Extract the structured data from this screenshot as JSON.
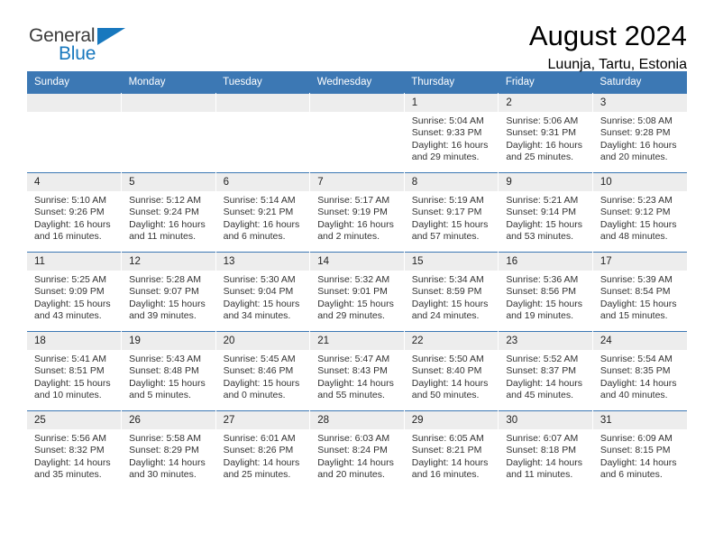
{
  "brand": {
    "name_part1": "General",
    "name_part2": "Blue",
    "triangle_color": "#1878be"
  },
  "header": {
    "title": "August 2024",
    "subtitle": "Luunja, Tartu, Estonia",
    "accent_color": "#3c78b4"
  },
  "weekdays": [
    "Sunday",
    "Monday",
    "Tuesday",
    "Wednesday",
    "Thursday",
    "Friday",
    "Saturday"
  ],
  "labels": {
    "sunrise": "Sunrise:",
    "sunset": "Sunset:",
    "daylight": "Daylight:"
  },
  "weeks": [
    [
      {
        "day": "",
        "blank": true
      },
      {
        "day": "",
        "blank": true
      },
      {
        "day": "",
        "blank": true
      },
      {
        "day": "",
        "blank": true
      },
      {
        "day": "1",
        "sunrise": "Sunrise: 5:04 AM",
        "sunset": "Sunset: 9:33 PM",
        "daylight1": "Daylight: 16 hours",
        "daylight2": "and 29 minutes."
      },
      {
        "day": "2",
        "sunrise": "Sunrise: 5:06 AM",
        "sunset": "Sunset: 9:31 PM",
        "daylight1": "Daylight: 16 hours",
        "daylight2": "and 25 minutes."
      },
      {
        "day": "3",
        "sunrise": "Sunrise: 5:08 AM",
        "sunset": "Sunset: 9:28 PM",
        "daylight1": "Daylight: 16 hours",
        "daylight2": "and 20 minutes."
      }
    ],
    [
      {
        "day": "4",
        "sunrise": "Sunrise: 5:10 AM",
        "sunset": "Sunset: 9:26 PM",
        "daylight1": "Daylight: 16 hours",
        "daylight2": "and 16 minutes."
      },
      {
        "day": "5",
        "sunrise": "Sunrise: 5:12 AM",
        "sunset": "Sunset: 9:24 PM",
        "daylight1": "Daylight: 16 hours",
        "daylight2": "and 11 minutes."
      },
      {
        "day": "6",
        "sunrise": "Sunrise: 5:14 AM",
        "sunset": "Sunset: 9:21 PM",
        "daylight1": "Daylight: 16 hours",
        "daylight2": "and 6 minutes."
      },
      {
        "day": "7",
        "sunrise": "Sunrise: 5:17 AM",
        "sunset": "Sunset: 9:19 PM",
        "daylight1": "Daylight: 16 hours",
        "daylight2": "and 2 minutes."
      },
      {
        "day": "8",
        "sunrise": "Sunrise: 5:19 AM",
        "sunset": "Sunset: 9:17 PM",
        "daylight1": "Daylight: 15 hours",
        "daylight2": "and 57 minutes."
      },
      {
        "day": "9",
        "sunrise": "Sunrise: 5:21 AM",
        "sunset": "Sunset: 9:14 PM",
        "daylight1": "Daylight: 15 hours",
        "daylight2": "and 53 minutes."
      },
      {
        "day": "10",
        "sunrise": "Sunrise: 5:23 AM",
        "sunset": "Sunset: 9:12 PM",
        "daylight1": "Daylight: 15 hours",
        "daylight2": "and 48 minutes."
      }
    ],
    [
      {
        "day": "11",
        "sunrise": "Sunrise: 5:25 AM",
        "sunset": "Sunset: 9:09 PM",
        "daylight1": "Daylight: 15 hours",
        "daylight2": "and 43 minutes."
      },
      {
        "day": "12",
        "sunrise": "Sunrise: 5:28 AM",
        "sunset": "Sunset: 9:07 PM",
        "daylight1": "Daylight: 15 hours",
        "daylight2": "and 39 minutes."
      },
      {
        "day": "13",
        "sunrise": "Sunrise: 5:30 AM",
        "sunset": "Sunset: 9:04 PM",
        "daylight1": "Daylight: 15 hours",
        "daylight2": "and 34 minutes."
      },
      {
        "day": "14",
        "sunrise": "Sunrise: 5:32 AM",
        "sunset": "Sunset: 9:01 PM",
        "daylight1": "Daylight: 15 hours",
        "daylight2": "and 29 minutes."
      },
      {
        "day": "15",
        "sunrise": "Sunrise: 5:34 AM",
        "sunset": "Sunset: 8:59 PM",
        "daylight1": "Daylight: 15 hours",
        "daylight2": "and 24 minutes."
      },
      {
        "day": "16",
        "sunrise": "Sunrise: 5:36 AM",
        "sunset": "Sunset: 8:56 PM",
        "daylight1": "Daylight: 15 hours",
        "daylight2": "and 19 minutes."
      },
      {
        "day": "17",
        "sunrise": "Sunrise: 5:39 AM",
        "sunset": "Sunset: 8:54 PM",
        "daylight1": "Daylight: 15 hours",
        "daylight2": "and 15 minutes."
      }
    ],
    [
      {
        "day": "18",
        "sunrise": "Sunrise: 5:41 AM",
        "sunset": "Sunset: 8:51 PM",
        "daylight1": "Daylight: 15 hours",
        "daylight2": "and 10 minutes."
      },
      {
        "day": "19",
        "sunrise": "Sunrise: 5:43 AM",
        "sunset": "Sunset: 8:48 PM",
        "daylight1": "Daylight: 15 hours",
        "daylight2": "and 5 minutes."
      },
      {
        "day": "20",
        "sunrise": "Sunrise: 5:45 AM",
        "sunset": "Sunset: 8:46 PM",
        "daylight1": "Daylight: 15 hours",
        "daylight2": "and 0 minutes."
      },
      {
        "day": "21",
        "sunrise": "Sunrise: 5:47 AM",
        "sunset": "Sunset: 8:43 PM",
        "daylight1": "Daylight: 14 hours",
        "daylight2": "and 55 minutes."
      },
      {
        "day": "22",
        "sunrise": "Sunrise: 5:50 AM",
        "sunset": "Sunset: 8:40 PM",
        "daylight1": "Daylight: 14 hours",
        "daylight2": "and 50 minutes."
      },
      {
        "day": "23",
        "sunrise": "Sunrise: 5:52 AM",
        "sunset": "Sunset: 8:37 PM",
        "daylight1": "Daylight: 14 hours",
        "daylight2": "and 45 minutes."
      },
      {
        "day": "24",
        "sunrise": "Sunrise: 5:54 AM",
        "sunset": "Sunset: 8:35 PM",
        "daylight1": "Daylight: 14 hours",
        "daylight2": "and 40 minutes."
      }
    ],
    [
      {
        "day": "25",
        "sunrise": "Sunrise: 5:56 AM",
        "sunset": "Sunset: 8:32 PM",
        "daylight1": "Daylight: 14 hours",
        "daylight2": "and 35 minutes."
      },
      {
        "day": "26",
        "sunrise": "Sunrise: 5:58 AM",
        "sunset": "Sunset: 8:29 PM",
        "daylight1": "Daylight: 14 hours",
        "daylight2": "and 30 minutes."
      },
      {
        "day": "27",
        "sunrise": "Sunrise: 6:01 AM",
        "sunset": "Sunset: 8:26 PM",
        "daylight1": "Daylight: 14 hours",
        "daylight2": "and 25 minutes."
      },
      {
        "day": "28",
        "sunrise": "Sunrise: 6:03 AM",
        "sunset": "Sunset: 8:24 PM",
        "daylight1": "Daylight: 14 hours",
        "daylight2": "and 20 minutes."
      },
      {
        "day": "29",
        "sunrise": "Sunrise: 6:05 AM",
        "sunset": "Sunset: 8:21 PM",
        "daylight1": "Daylight: 14 hours",
        "daylight2": "and 16 minutes."
      },
      {
        "day": "30",
        "sunrise": "Sunrise: 6:07 AM",
        "sunset": "Sunset: 8:18 PM",
        "daylight1": "Daylight: 14 hours",
        "daylight2": "and 11 minutes."
      },
      {
        "day": "31",
        "sunrise": "Sunrise: 6:09 AM",
        "sunset": "Sunset: 8:15 PM",
        "daylight1": "Daylight: 14 hours",
        "daylight2": "and 6 minutes."
      }
    ]
  ]
}
